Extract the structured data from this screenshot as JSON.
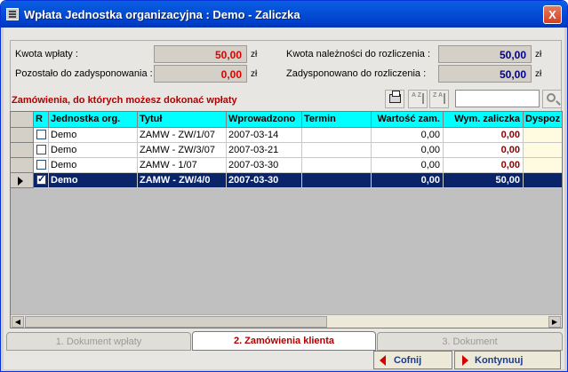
{
  "window": {
    "title": "Wpłata Jednostka organizacyjna : Demo - Zaliczka",
    "close_label": "X"
  },
  "summary": {
    "kwota_wplaty_label": "Kwota wpłaty :",
    "kwota_wplaty_value": "50,00",
    "pozostalo_label": "Pozostało do zadysponowania :",
    "pozostalo_value": "0,00",
    "naleznosci_label": "Kwota należności do rozliczenia :",
    "naleznosci_value": "50,00",
    "zadysponowano_label": "Zadysponowano do rozliczenia :",
    "zadysponowano_value": "50,00",
    "currency": "zł"
  },
  "section_title": "Zamówienia, do których możesz dokonać wpłaty",
  "toolbar": {
    "print_icon": "printer-icon",
    "sort_asc_icon": "sort-asc-icon",
    "sort_desc_icon": "sort-desc-icon",
    "sort_asc_text": "A Z",
    "sort_desc_text": "Z A",
    "search_value": ""
  },
  "grid": {
    "columns": [
      "R",
      "Jednostka org.",
      "Tytuł",
      "Wprowadzono",
      "Termin",
      "Wartość zam.",
      "Wym. zaliczka",
      "Dyspoz"
    ],
    "rows": [
      {
        "checked": false,
        "jednostka": "Demo",
        "tytul": "ZAMW - ZW/1/07",
        "wprowadzono": "2007-03-14",
        "termin": "",
        "wartosc": "0,00",
        "zaliczka": "0,00",
        "dyspoz": ""
      },
      {
        "checked": false,
        "jednostka": "Demo",
        "tytul": "ZAMW - ZW/3/07",
        "wprowadzono": "2007-03-21",
        "termin": "",
        "wartosc": "0,00",
        "zaliczka": "0,00",
        "dyspoz": ""
      },
      {
        "checked": false,
        "jednostka": "Demo",
        "tytul": "ZAMW - 1/07",
        "wprowadzono": "2007-03-30",
        "termin": "",
        "wartosc": "0,00",
        "zaliczka": "0,00",
        "dyspoz": ""
      },
      {
        "checked": true,
        "jednostka": "Demo",
        "tytul": "ZAMW - ZW/4/0",
        "wprowadzono": "2007-03-30",
        "termin": "",
        "wartosc": "0,00",
        "zaliczka": "50,00",
        "dyspoz": ""
      }
    ]
  },
  "scroll": {
    "left": "◀",
    "right": "▶"
  },
  "tabs": [
    {
      "label": "1. Dokument wpłaty",
      "active": false
    },
    {
      "label": "2. Zamówienia klienta",
      "active": true
    },
    {
      "label": "3. Dokument",
      "active": false
    }
  ],
  "buttons": {
    "back": "Cofnij",
    "next": "Kontynuuj"
  }
}
